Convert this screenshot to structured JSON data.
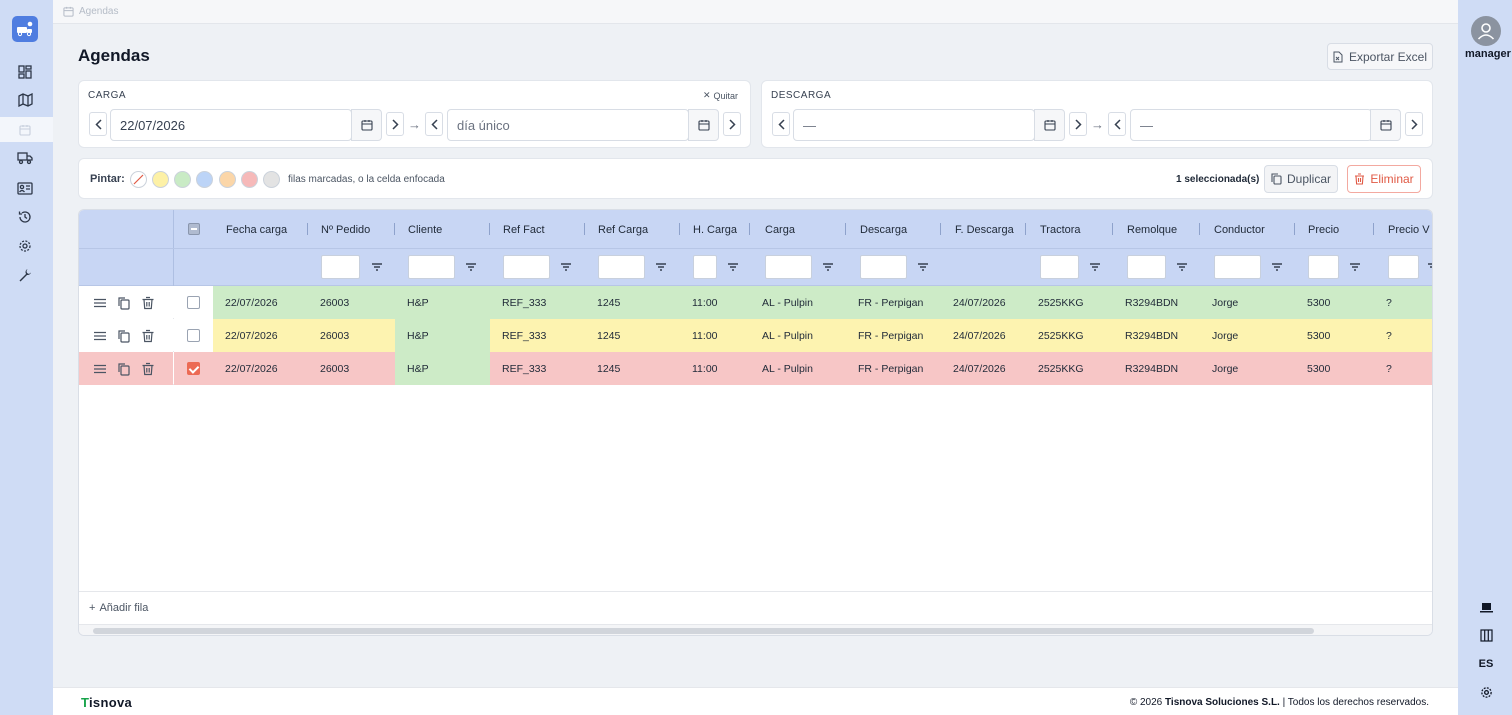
{
  "breadcrumb": "Agendas",
  "page_title": "Agendas",
  "export_label": "Exportar Excel",
  "carga": {
    "label": "CARGA",
    "quitar": "Quitar",
    "from": "22/07/2026",
    "to_placeholder": "día único"
  },
  "descarga": {
    "label": "DESCARGA",
    "from": "—",
    "to": "—"
  },
  "paint": {
    "label": "Pintar:",
    "hint": "filas marcadas, o la celda enfocada",
    "swatches": [
      "none",
      "#fdf1a6",
      "#c9ebc5",
      "#bcd4f7",
      "#fbd6a8",
      "#f6b9b9",
      "#e3e3e3"
    ]
  },
  "selection": {
    "count": "1 seleccionada(s)",
    "duplicate": "Duplicar",
    "delete": "Eliminar"
  },
  "table": {
    "columns": [
      "Fecha carga",
      "Nº Pedido",
      "Cliente",
      "Ref Fact",
      "Ref Carga",
      "H. Carga",
      "Carga",
      "Descarga",
      "F. Descarga",
      "Tractora",
      "Remolque",
      "Conductor",
      "Precio",
      "Precio V"
    ],
    "rows": [
      {
        "checked": false,
        "cells": [
          "22/07/2026",
          "26003",
          "H&P",
          "REF_333",
          "1245",
          "11:00",
          "AL - Pulpin",
          "FR - Perpigan",
          "24/07/2026",
          "2525KKG",
          "R3294BDN",
          "Jorge",
          "5300",
          "?"
        ]
      },
      {
        "checked": false,
        "cells": [
          "22/07/2026",
          "26003",
          "H&P",
          "REF_333",
          "1245",
          "11:00",
          "AL - Pulpin",
          "FR - Perpigan",
          "24/07/2026",
          "2525KKG",
          "R3294BDN",
          "Jorge",
          "5300",
          "?"
        ]
      },
      {
        "checked": true,
        "cells": [
          "22/07/2026",
          "26003",
          "H&P",
          "REF_333",
          "1245",
          "11:00",
          "AL - Pulpin",
          "FR - Perpigan",
          "24/07/2026",
          "2525KKG",
          "R3294BDN",
          "Jorge",
          "5300",
          "?"
        ]
      }
    ],
    "add_row": "Añadir fila"
  },
  "colors": {
    "green": "#cdebc7",
    "yellow": "#fdf3b0",
    "red": "#f7c6c6",
    "accent": "#4f7de0",
    "danger": "#e05a45"
  },
  "user": {
    "name": "manager"
  },
  "lang": "ES",
  "footer": {
    "brand_mark": "T",
    "brand_rest": "isnova",
    "copyright": "© 2026 ",
    "company": "Tisnova Soluciones S.L.",
    "rights": " | Todos los derechos reservados."
  }
}
